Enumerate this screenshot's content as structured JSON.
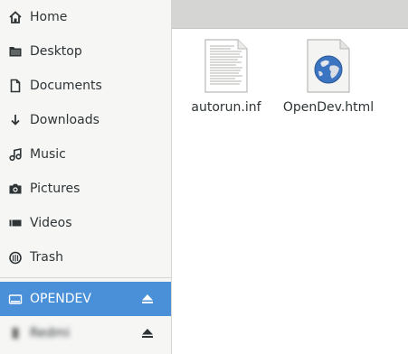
{
  "sidebar": {
    "places": [
      {
        "label": "Home",
        "icon": "home-icon"
      },
      {
        "label": "Desktop",
        "icon": "folder-icon"
      },
      {
        "label": "Documents",
        "icon": "document-icon"
      },
      {
        "label": "Downloads",
        "icon": "download-icon"
      },
      {
        "label": "Music",
        "icon": "music-icon"
      },
      {
        "label": "Pictures",
        "icon": "camera-icon"
      },
      {
        "label": "Videos",
        "icon": "video-icon"
      },
      {
        "label": "Trash",
        "icon": "trash-icon"
      }
    ],
    "devices": [
      {
        "label": "OPENDEV",
        "icon": "drive-icon",
        "selected": true
      },
      {
        "label": "Redmi",
        "icon": "phone-icon",
        "selected": false
      }
    ]
  },
  "files": [
    {
      "name": "autorun.inf",
      "icon": "text-file-icon"
    },
    {
      "name": "OpenDev.html",
      "icon": "html-globe-file-icon"
    }
  ],
  "colors": {
    "selection": "#4a90d9",
    "sidebar_bg": "#f6f6f5",
    "pathbar_bg": "#d5d5d3",
    "text": "#2e3436"
  }
}
